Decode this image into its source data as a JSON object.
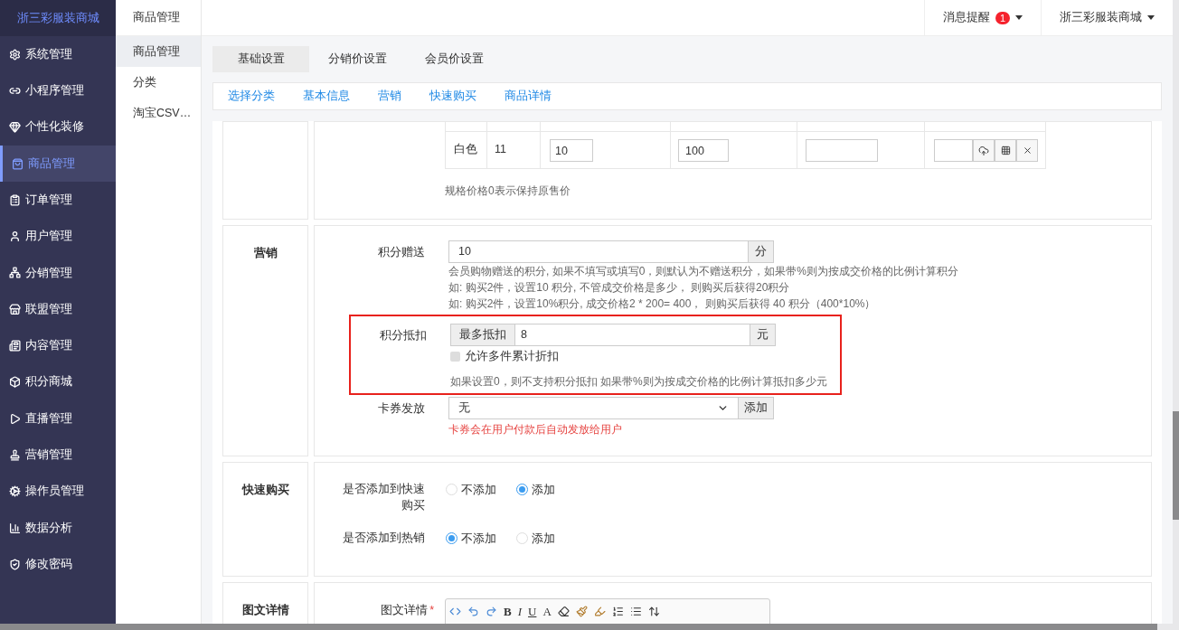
{
  "brand": "浙三彩服装商城",
  "sidebar": {
    "items": [
      {
        "label": "系统管理",
        "selected": false
      },
      {
        "label": "小程序管理",
        "selected": false
      },
      {
        "label": "个性化装修",
        "selected": false
      },
      {
        "label": "商品管理",
        "selected": true
      },
      {
        "label": "订单管理",
        "selected": false
      },
      {
        "label": "用户管理",
        "selected": false
      },
      {
        "label": "分销管理",
        "selected": false
      },
      {
        "label": "联盟管理",
        "selected": false
      },
      {
        "label": "内容管理",
        "selected": false
      },
      {
        "label": "积分商城",
        "selected": false
      },
      {
        "label": "直播管理",
        "selected": false
      },
      {
        "label": "营销管理",
        "selected": false
      },
      {
        "label": "操作员管理",
        "selected": false
      },
      {
        "label": "数据分析",
        "selected": false
      },
      {
        "label": "修改密码",
        "selected": false
      }
    ]
  },
  "submenu": {
    "title": "商品管理",
    "items": [
      {
        "label": "商品管理",
        "selected": true
      },
      {
        "label": "分类",
        "selected": false
      },
      {
        "label": "淘宝CSV…",
        "selected": false
      }
    ]
  },
  "header": {
    "notifications": {
      "label": "消息提醒",
      "badge": "1"
    },
    "account": "浙三彩服装商城"
  },
  "tabs": [
    {
      "label": "基础设置",
      "selected": true
    },
    {
      "label": "分销价设置",
      "selected": false
    },
    {
      "label": "会员价设置",
      "selected": false
    }
  ],
  "anchor_nav": [
    "选择分类",
    "基本信息",
    "营销",
    "快速购买",
    "商品详情"
  ],
  "spec_table": {
    "rows": [
      {
        "spec": "白色",
        "stock": "11",
        "price": "10",
        "value_2": "100"
      }
    ],
    "note": "规格价格0表示保持原售价"
  },
  "marketing": {
    "title": "营销",
    "points_gift": {
      "label": "积分赠送",
      "value": "10",
      "unit": "分",
      "notes": [
        "会员购物赠送的积分, 如果不填写或填写0，则默认为不赠送积分，如果带%则为按成交价格的比例计算积分",
        "如: 购买2件，设置10 积分, 不管成交价格是多少， 则购买后获得20积分",
        "如: 购买2件，设置10%积分, 成交价格2 * 200= 400， 则购买后获得 40 积分（400*10%）"
      ]
    },
    "points_deduct": {
      "label": "积分抵扣",
      "highlighted": true,
      "prefix": "最多抵扣",
      "value": "8",
      "unit": "元",
      "checkbox": {
        "label": "允许多件累计折扣",
        "checked": false
      },
      "note": "如果设置0，则不支持积分抵扣 如果带%则为按成交价格的比例计算抵扣多少元"
    },
    "coupon": {
      "label": "卡券发放",
      "value": "无",
      "button": "添加",
      "note": "卡券会在用户付款后自动发放给用户"
    }
  },
  "quick_buy": {
    "title": "快速购买",
    "questions": [
      {
        "label": "是否添加到快速购买",
        "options": [
          {
            "label": "不添加",
            "selected": false
          },
          {
            "label": "添加",
            "selected": true
          }
        ]
      },
      {
        "label": "是否添加到热销",
        "options": [
          {
            "label": "不添加",
            "selected": true
          },
          {
            "label": "添加",
            "selected": false
          }
        ]
      }
    ]
  },
  "detail": {
    "title": "图文详情",
    "field_label": "图文详情",
    "required": true,
    "required_mark": "*",
    "toolbar_letters": [
      "B",
      "I",
      "U",
      "A"
    ]
  }
}
